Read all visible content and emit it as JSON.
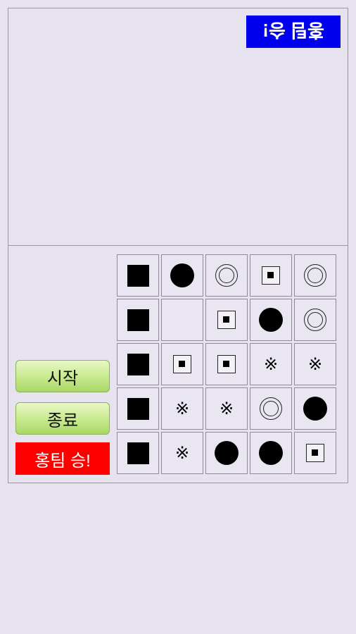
{
  "banner": {
    "text": "홍팀 승!",
    "color": "#0000ee"
  },
  "controls": {
    "start_label": "시작",
    "end_label": "종료",
    "status_text": "홍팀 승!",
    "status_color": "#ff0000"
  },
  "board": {
    "rows": 5,
    "cols": 5,
    "cells": [
      [
        "square",
        "circle",
        "double-circle",
        "boxed-square",
        "double-circle"
      ],
      [
        "square",
        "empty",
        "boxed-square",
        "circle",
        "double-circle"
      ],
      [
        "square",
        "boxed-square",
        "boxed-square",
        "reference-mark",
        "reference-mark"
      ],
      [
        "square",
        "reference-mark",
        "reference-mark",
        "double-circle",
        "circle"
      ],
      [
        "square",
        "reference-mark",
        "circle",
        "circle",
        "boxed-square"
      ]
    ]
  }
}
